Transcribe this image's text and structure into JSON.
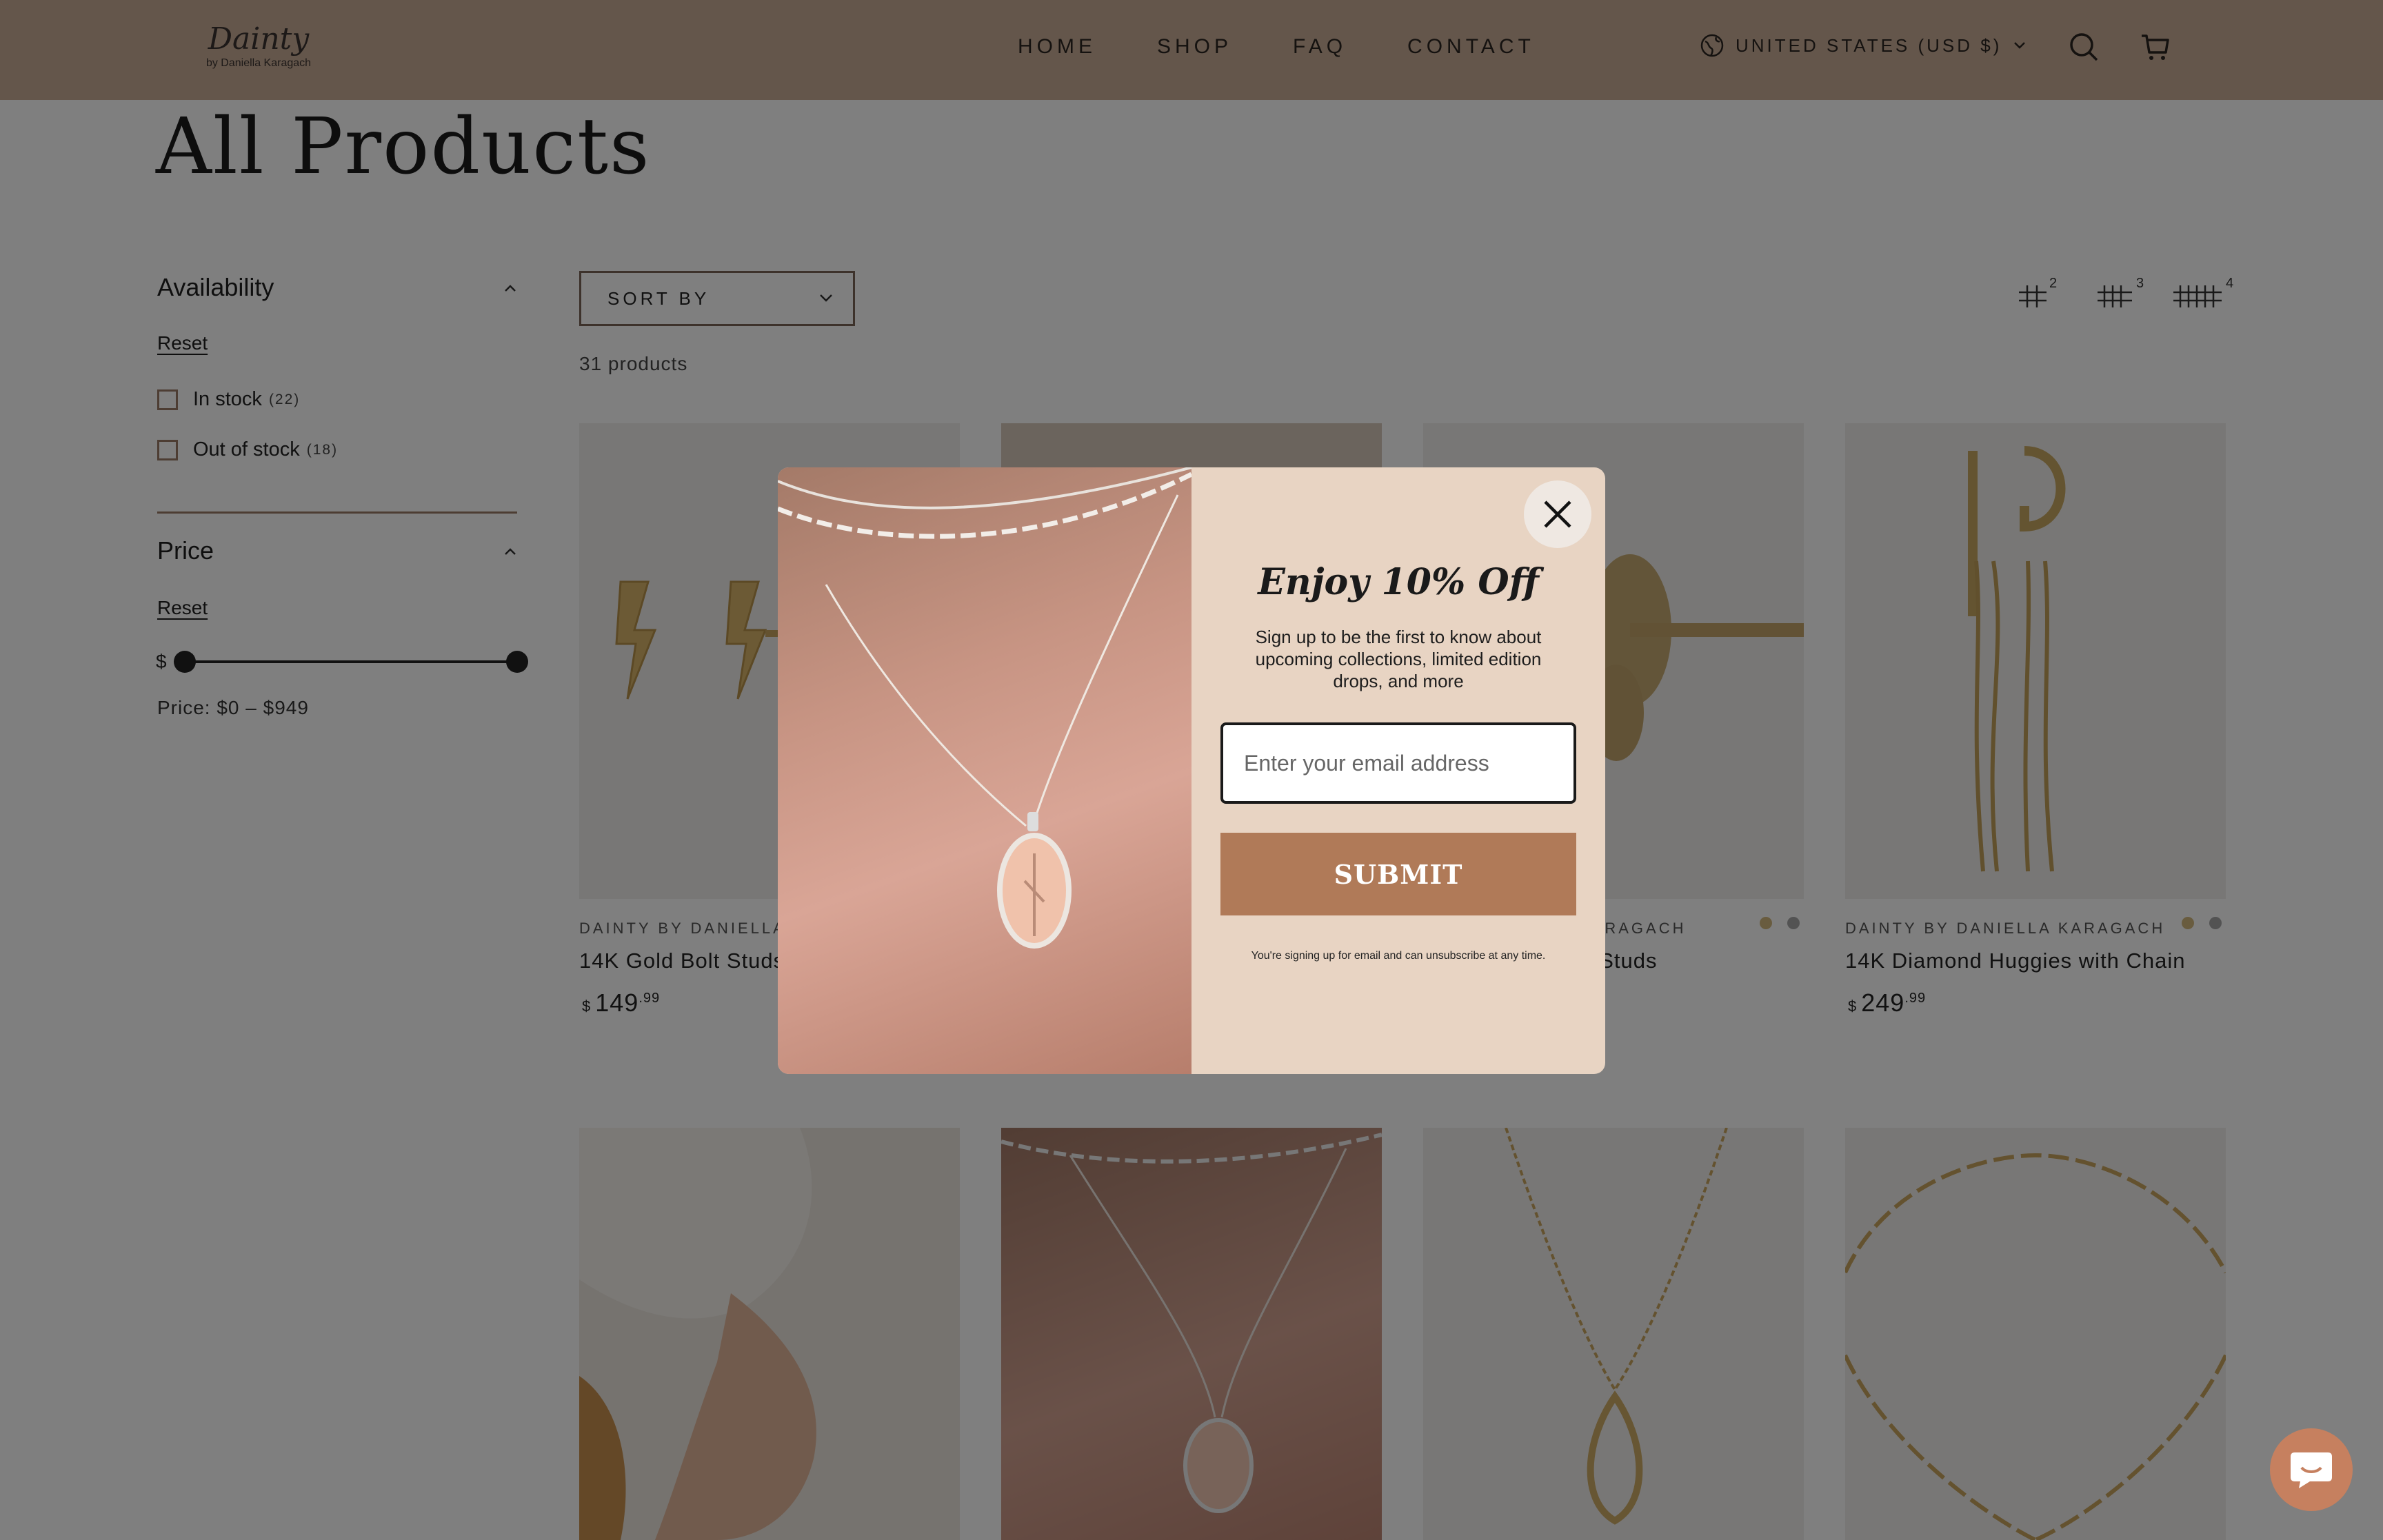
{
  "header": {
    "logo_script": "Dainty",
    "logo_sub": "by Daniella Karagach",
    "nav": [
      "HOME",
      "SHOP",
      "FAQ",
      "CONTACT"
    ],
    "currency": "UNITED STATES (USD $)"
  },
  "page": {
    "title": "All Products"
  },
  "filters": {
    "availability": {
      "heading": "Availability",
      "reset": "Reset",
      "options": [
        {
          "label": "In stock",
          "count": "(22)"
        },
        {
          "label": "Out of stock",
          "count": "(18)"
        }
      ]
    },
    "price": {
      "heading": "Price",
      "reset": "Reset",
      "currency_symbol": "$",
      "summary": "Price: $0 – $949",
      "min_fraction": 0,
      "max_fraction": 1
    }
  },
  "toolbar": {
    "sort_label": "SORT BY",
    "product_count": "31 products",
    "grid_options": [
      "2",
      "3",
      "4"
    ]
  },
  "products": [
    {
      "brand": "DAINTY BY DANIELLA KA",
      "name": "14K Gold Bolt Studs",
      "price_currency": "$",
      "price_whole": "149",
      "price_cents": ".99"
    },
    {
      "brand": "",
      "name": "",
      "price_currency": "",
      "price_whole": "",
      "price_cents": ""
    },
    {
      "brand": "KARAGACH",
      "name": "f Studs",
      "price_currency": "",
      "price_whole": "",
      "price_cents": ""
    },
    {
      "brand": "DAINTY BY DANIELLA KARAGACH",
      "name": "14K Diamond Huggies with Chain",
      "price_currency": "$",
      "price_whole": "249",
      "price_cents": ".99"
    }
  ],
  "modal": {
    "title": "Enjoy 10% Off",
    "description": "Sign up to be the first to know about upcoming collections, limited edition drops, and more",
    "email_placeholder": "Enter your email address",
    "submit_label": "SUBMIT",
    "fine_print": "You're signing up for email and can unsubscribe at any time."
  },
  "colors": {
    "header_bg": "#c9ad96",
    "modal_bg": "#e8d4c3",
    "submit_bg": "#b07a58",
    "chat_bg": "#c6805f"
  },
  "icons": [
    "globe-icon",
    "chevron-down-icon",
    "search-icon",
    "cart-icon",
    "close-icon",
    "chat-icon",
    "grid-2-icon",
    "grid-3-icon",
    "grid-4-icon"
  ]
}
